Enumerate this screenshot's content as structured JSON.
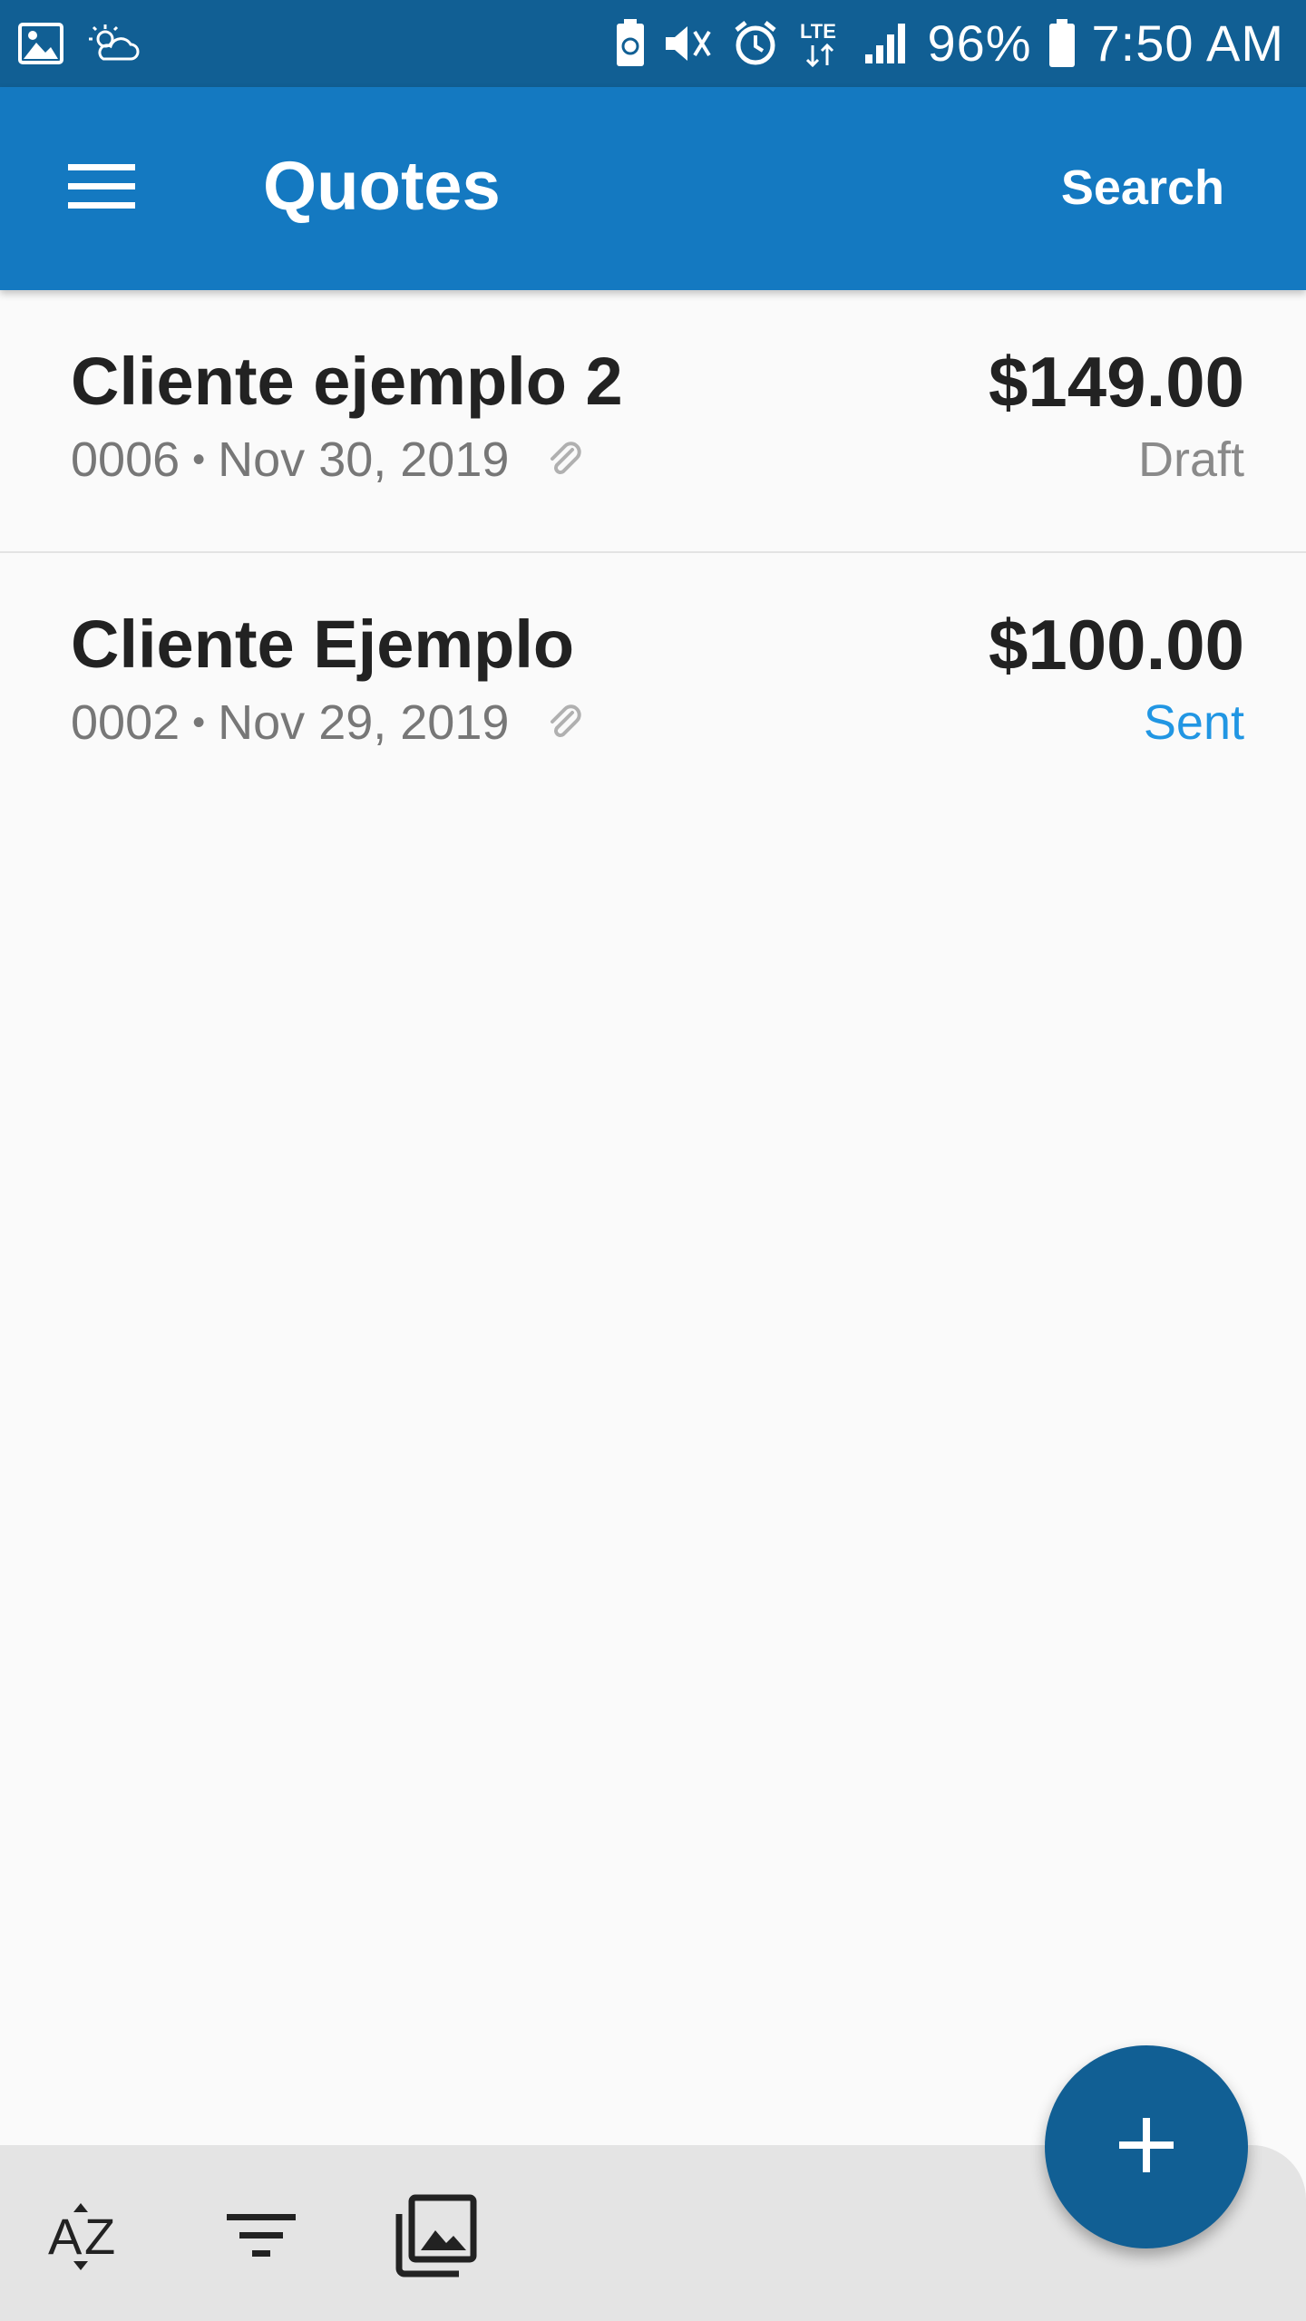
{
  "status_bar": {
    "battery_percent": "96%",
    "time": "7:50 AM",
    "left_icons": [
      "gallery-icon",
      "weather-icon"
    ],
    "right_icons": [
      "battery-saver-icon",
      "mute-icon",
      "alarm-icon",
      "lte-icon",
      "signal-icon",
      "battery-icon"
    ],
    "lte_label": "LTE"
  },
  "app_bar": {
    "title": "Quotes",
    "search_label": "Search"
  },
  "quotes": [
    {
      "client": "Cliente ejemplo 2",
      "number": "0006",
      "date": "Nov 30, 2019",
      "amount": "$149.00",
      "status": "Draft",
      "status_color": "#8a8a8a",
      "has_attachment": true
    },
    {
      "client": "Cliente Ejemplo",
      "number": "0002",
      "date": "Nov 29, 2019",
      "amount": "$100.00",
      "status": "Sent",
      "status_color": "#2196e3",
      "has_attachment": true
    }
  ],
  "bottom_bar": {
    "icons": [
      "sort-az-icon",
      "filter-icon",
      "gallery-view-icon"
    ]
  },
  "fab": {
    "icon": "plus-icon"
  },
  "colors": {
    "status_bar": "#115f94",
    "app_bar": "#1479c1",
    "fab": "#115f94"
  }
}
